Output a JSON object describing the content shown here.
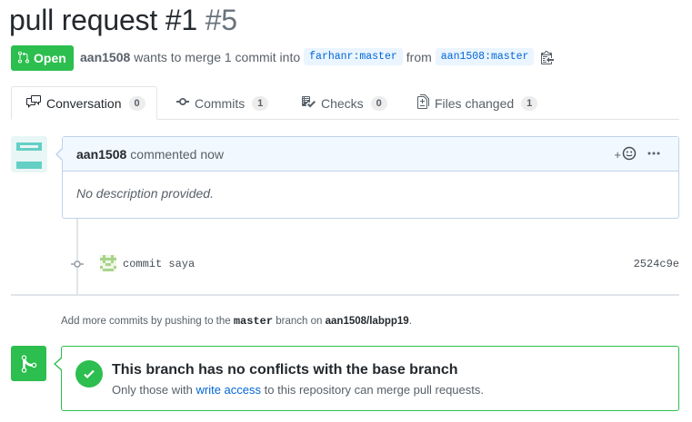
{
  "pr": {
    "title": "pull request #1",
    "number": "#5",
    "state": "Open",
    "author": "aan1508",
    "summary": "wants to merge 1 commit into",
    "base_ref": "farhanr:master",
    "from_word": "from",
    "head_ref": "aan1508:master"
  },
  "tabs": [
    {
      "label": "Conversation",
      "count": "0",
      "icon": "comment-discussion-icon"
    },
    {
      "label": "Commits",
      "count": "1",
      "icon": "git-commit-icon"
    },
    {
      "label": "Checks",
      "count": "0",
      "icon": "checklist-icon"
    },
    {
      "label": "Files changed",
      "count": "1",
      "icon": "file-diff-icon"
    }
  ],
  "comment": {
    "author": "aan1508",
    "action": "commented now",
    "body": "No description provided.",
    "reaction_label": "+"
  },
  "commit": {
    "message": "commit saya",
    "sha": "2524c9e"
  },
  "hint": {
    "prefix": "Add more commits by pushing to the",
    "branch": "master",
    "middle": "branch on",
    "repo": "aan1508/labpp19",
    "suffix": "."
  },
  "merge": {
    "title": "This branch has no conflicts with the base branch",
    "desc_prefix": "Only those with",
    "desc_link": "write access",
    "desc_suffix": "to this repository can merge pull requests."
  },
  "colors": {
    "open_green": "#2cbe4e",
    "link_blue": "#0366d6",
    "comment_header_bg": "#f1f8ff"
  }
}
